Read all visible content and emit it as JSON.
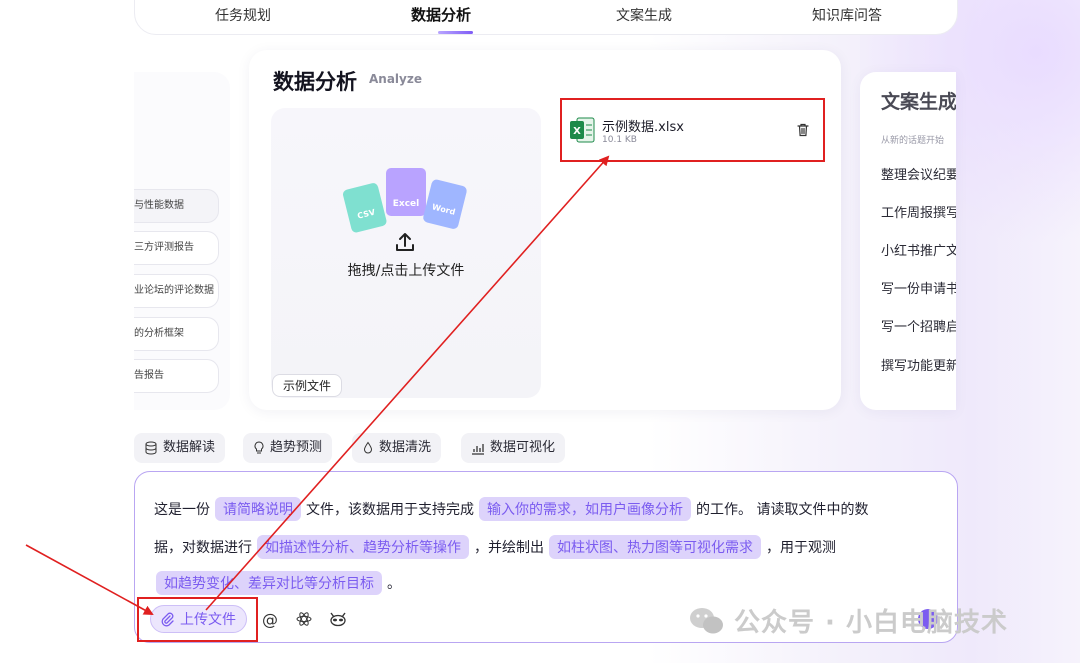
{
  "top_tabs": [
    {
      "label": "任务规划"
    },
    {
      "label": "数据分析"
    },
    {
      "label": "文案生成"
    },
    {
      "label": "知识库问答"
    }
  ],
  "left_card": {
    "items": [
      "与性能数据",
      "三方评测报告",
      "业论坛的评论数据",
      "的分析框架",
      "告报告"
    ]
  },
  "analyze_card": {
    "title": "数据分析",
    "subtitle": "Analyze",
    "upload_text": "拖拽/点击上传文件",
    "example_button": "示例文件",
    "file_badges": [
      "CSV",
      "Excel",
      "Word"
    ],
    "file": {
      "name": "示例数据.xlsx",
      "size": "10.1 KB"
    }
  },
  "right_card": {
    "title": "文案生成",
    "subtitle": "从新的话题开始",
    "items": [
      "整理会议纪要",
      "工作周报撰写",
      "小红书推广文",
      "写一份申请书",
      "写一个招聘启",
      "撰写功能更新"
    ]
  },
  "chips": [
    {
      "label": "数据解读",
      "icon": "database-icon"
    },
    {
      "label": "趋势预测",
      "icon": "lightbulb-icon"
    },
    {
      "label": "数据清洗",
      "icon": "drop-icon"
    },
    {
      "label": "数据可视化",
      "icon": "chart-icon"
    }
  ],
  "prompt": {
    "line1_a": "这是一份",
    "slot1": "请简略说明",
    "line1_b": "文件，该数据用于支持完成",
    "slot2": "输入你的需求，如用户画像分析",
    "line1_c": "的工作。 请读取文件中的数",
    "line2_a": "据，对数据进行",
    "slot3": "如描述性分析、趋势分析等操作",
    "line2_b": "，并绘制出",
    "slot4": "如柱状图、热力图等可视化需求",
    "line2_c": "，用于观测",
    "slot5": "如趋势变化、差异对比等分析目标",
    "line3_end": "。",
    "upload_button": "上传文件"
  },
  "watermark": "公众号 · 小白电脑技术",
  "colors": {
    "accent": "#7b5cf0",
    "annotation_red": "#e02020",
    "slot_bg": "#ddd3fb"
  }
}
